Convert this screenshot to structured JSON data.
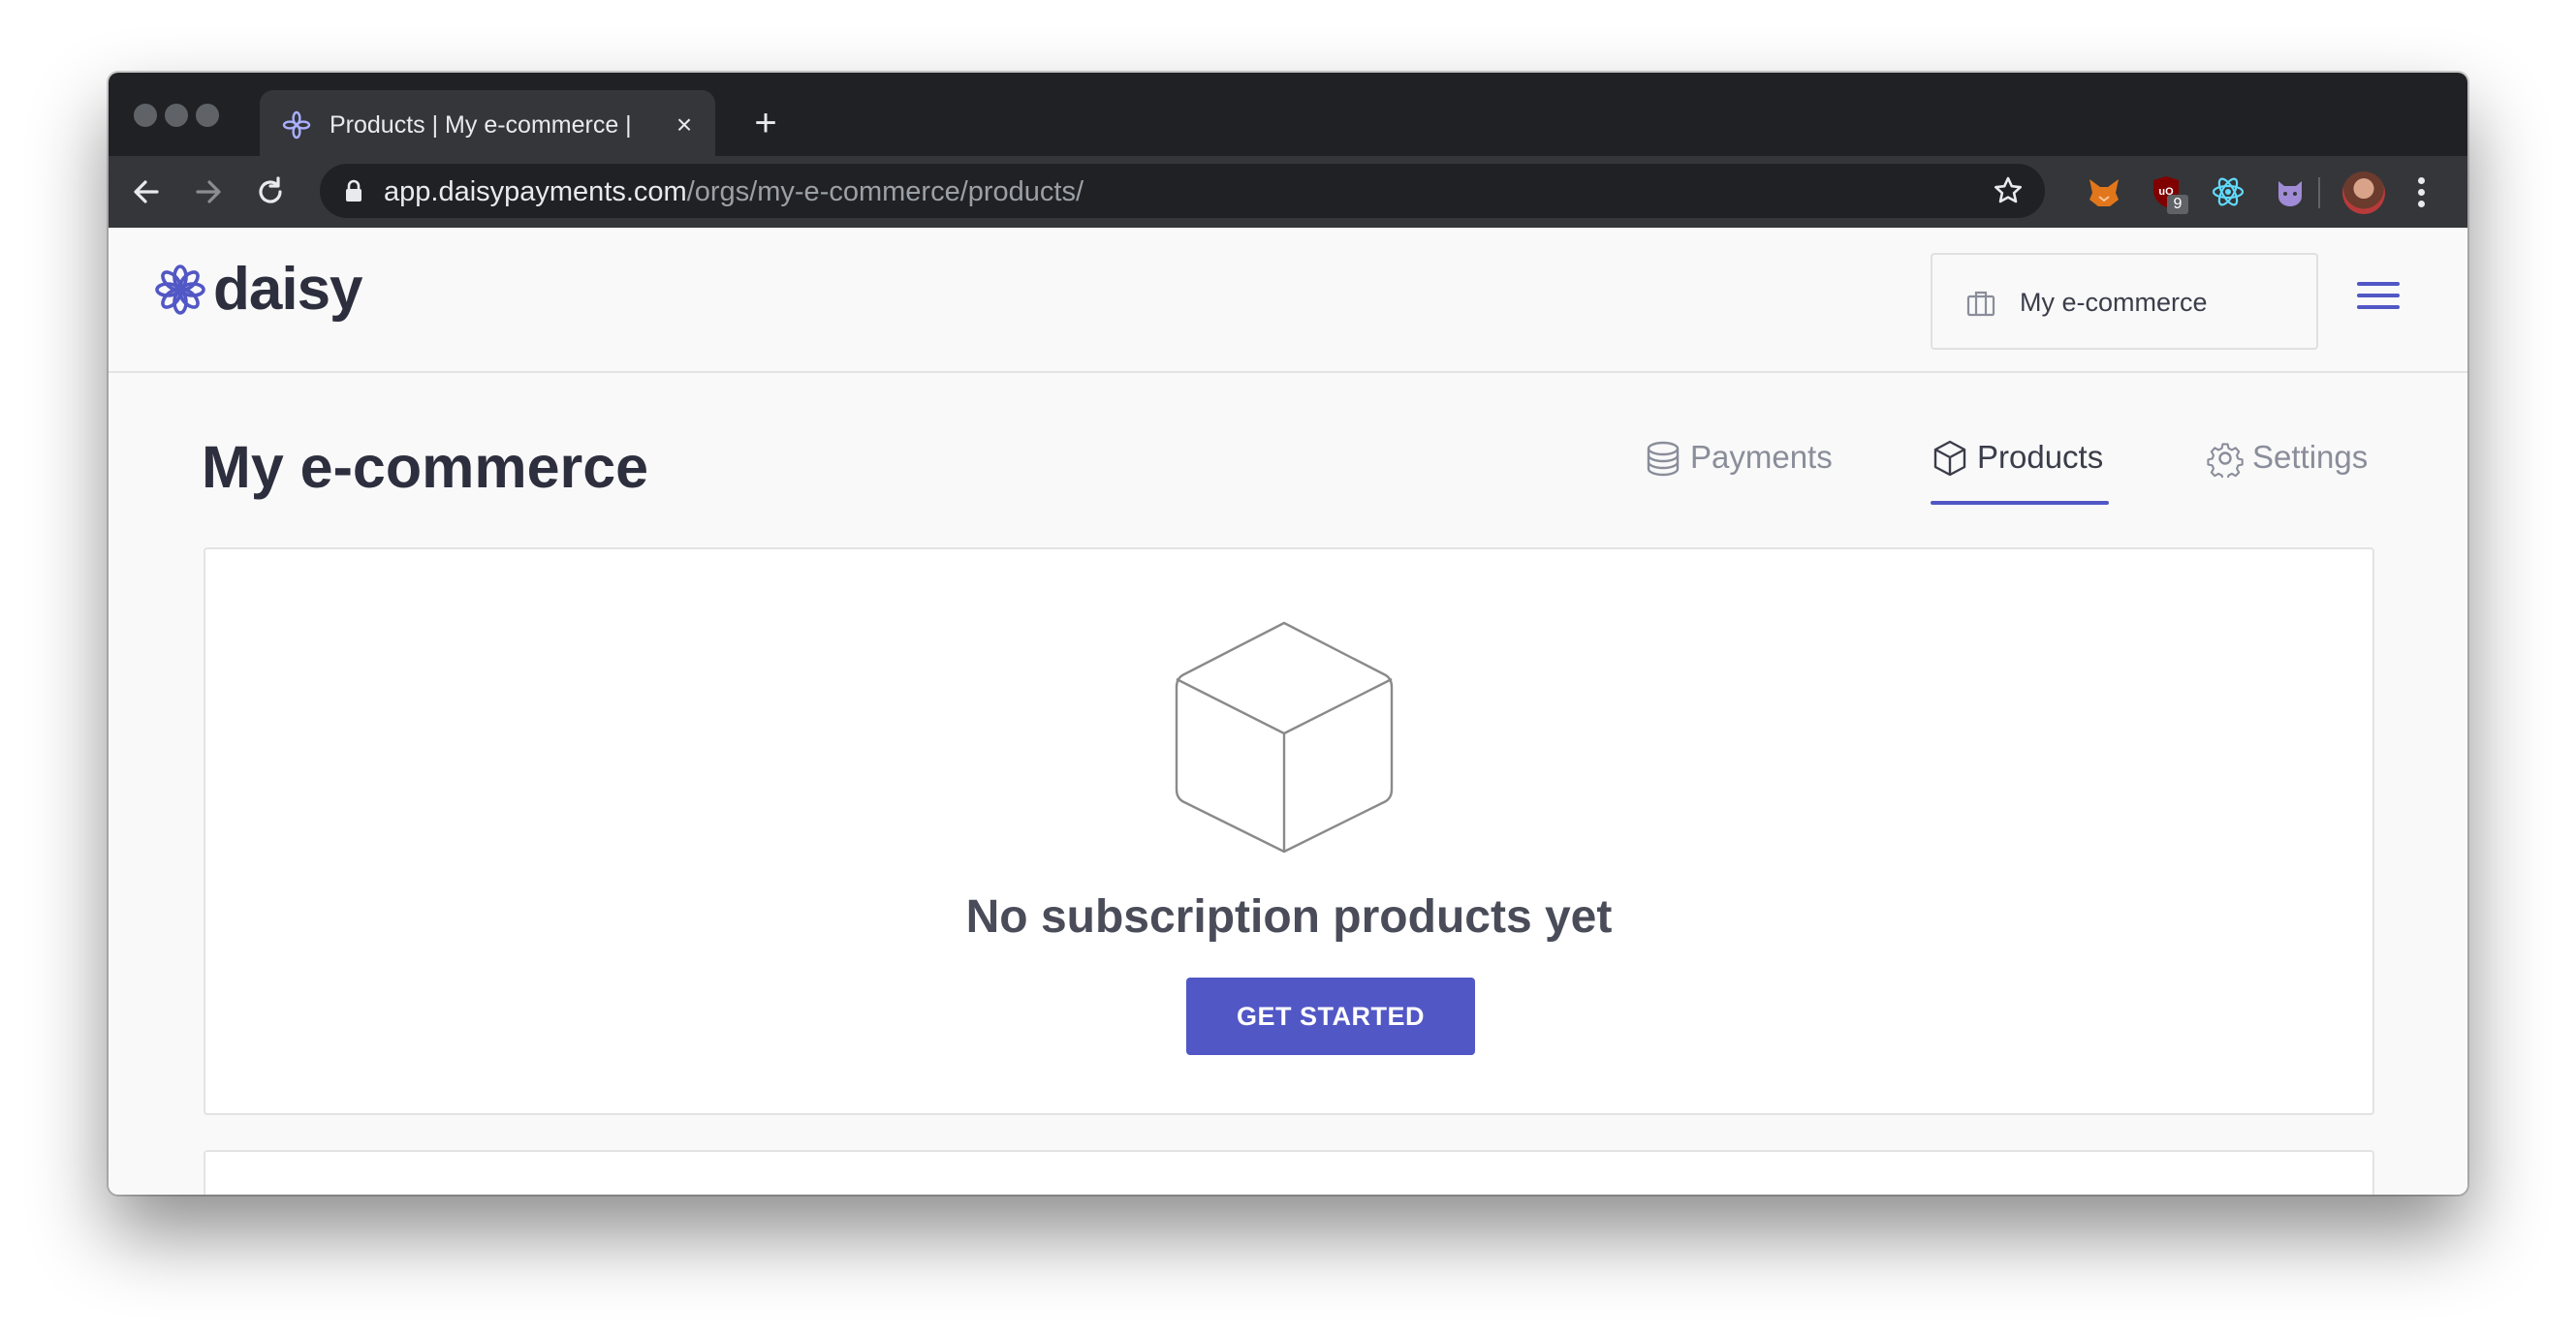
{
  "browser": {
    "tab_title": "Products | My e-commerce | Daisy",
    "url_host": "app.daisypayments.com",
    "url_path": "/orgs/my-e-commerce/products/",
    "extension_badge": "9"
  },
  "header": {
    "logo_text": "daisy",
    "org_name": "My e-commerce"
  },
  "main": {
    "page_title": "My e-commerce",
    "tabs": [
      {
        "label": "Payments",
        "icon": "coins-icon",
        "active": false
      },
      {
        "label": "Products",
        "icon": "box-icon",
        "active": true
      },
      {
        "label": "Settings",
        "icon": "gear-icon",
        "active": false
      }
    ],
    "empty_state": {
      "message": "No subscription products yet",
      "button_label": "GET STARTED"
    }
  },
  "colors": {
    "accent": "#5157c5",
    "heading": "#2d2f3e",
    "muted": "#8a8d9a"
  }
}
